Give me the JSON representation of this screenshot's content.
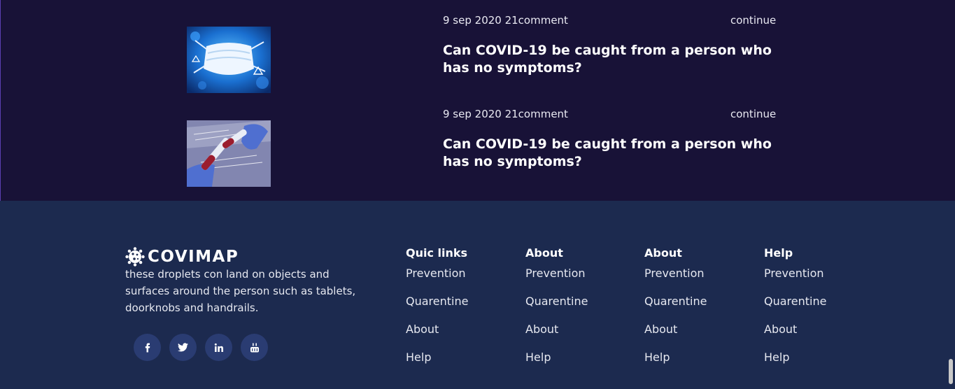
{
  "posts": [
    {
      "meta": "9 sep 2020 21comment",
      "continue_label": "continue",
      "title": "Can COVID-19 be caught from a person who has no symptoms?",
      "image": "face-mask-virus-image"
    },
    {
      "meta": "9 sep 2020 21comment",
      "continue_label": "continue",
      "title": "Can COVID-19 be caught from a person who has no symptoms?",
      "image": "blood-test-tube-image"
    }
  ],
  "footer": {
    "brand": "COVIMAP",
    "logo_icon": "virus-icon",
    "description": "these droplets con land on objects and surfaces around the person such as tablets, doorknobs and handrails.",
    "social": [
      {
        "icon": "facebook-icon"
      },
      {
        "icon": "twitter-icon"
      },
      {
        "icon": "linkedin-icon"
      },
      {
        "icon": "youtube-icon"
      }
    ],
    "columns": [
      {
        "title": "Quic links",
        "links": [
          "Prevention",
          "Quarentine",
          "About",
          "Help"
        ]
      },
      {
        "title": "About",
        "links": [
          "Prevention",
          "Quarentine",
          "About",
          "Help"
        ]
      },
      {
        "title": "About",
        "links": [
          "Prevention",
          "Quarentine",
          "About",
          "Help"
        ]
      },
      {
        "title": "Help",
        "links": [
          "Prevention",
          "Quarentine",
          "About",
          "Help"
        ]
      }
    ]
  },
  "colors": {
    "news_bg": "#181237",
    "footer_bg": "#1c2a4f",
    "social_bg": "#2a3c72",
    "text": "#ffffff"
  }
}
